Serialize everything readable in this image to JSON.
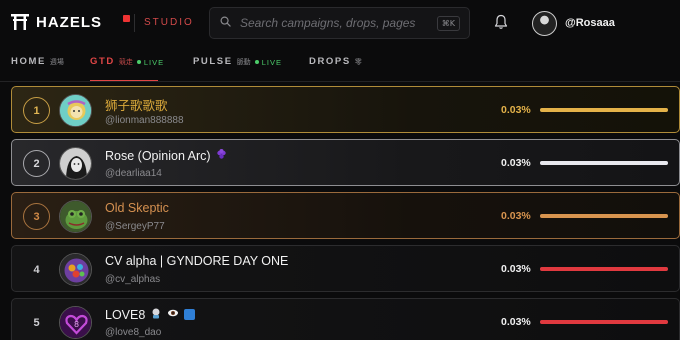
{
  "header": {
    "brand": "HAZELS",
    "section": "STUDIO",
    "search_placeholder": "Search campaigns, drops, pages",
    "shortcut": "⌘K",
    "icons": {
      "logo": "hazels-logo-icon",
      "search": "search-icon",
      "bell": "bell-icon"
    },
    "username": "@Rosaaa"
  },
  "tabs": [
    {
      "label": "HOME",
      "sub": "週場",
      "live": ""
    },
    {
      "label": "GTD",
      "sub": "競走",
      "live": "LIVE",
      "active": true
    },
    {
      "label": "PULSE",
      "sub": "脈動",
      "live": "LIVE"
    },
    {
      "label": "DROPS",
      "sub": "零",
      "live": ""
    }
  ],
  "colors": {
    "accent": "#e04646",
    "live": "#4ccd6a",
    "gold": "#e4b249",
    "silver": "#e8e8ee",
    "bronze": "#d8944f",
    "default_bar": "#e0393f"
  },
  "leaderboard": [
    {
      "rank": "1",
      "name": "狮子歌歌歌",
      "badge": "",
      "handle": "@lionman888888",
      "percent": "0.03%",
      "tier": "gold"
    },
    {
      "rank": "2",
      "name": "Rose (Opinion Arc)",
      "badge": "🍇",
      "handle": "@dearliaa14",
      "percent": "0.03%",
      "tier": "silver"
    },
    {
      "rank": "3",
      "name": "Old Skeptic",
      "badge": "",
      "handle": "@SergeyP77",
      "percent": "0.03%",
      "tier": "bronze"
    },
    {
      "rank": "4",
      "name": "CV alpha | GYNDORE DAY ONE",
      "badge": "",
      "handle": "@cv_alphas",
      "percent": "0.03%",
      "tier": "default"
    },
    {
      "rank": "5",
      "name": "LOVE8",
      "badge": "🧑‍🚀 👁️ 🟦",
      "handle": "@love8_dao",
      "percent": "0.03%",
      "tier": "default"
    }
  ]
}
